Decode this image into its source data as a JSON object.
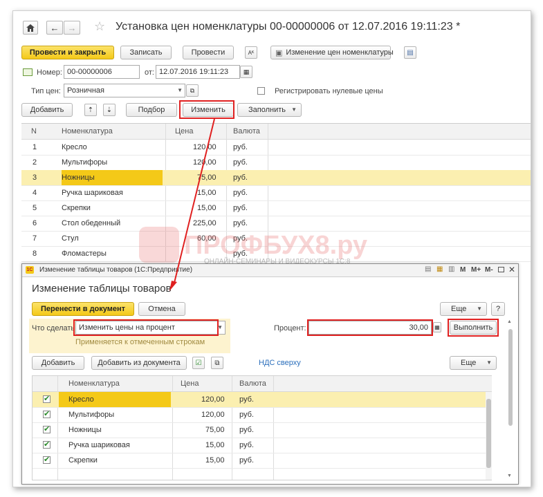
{
  "main_window": {
    "title": "Установка цен номенклатуры 00-00000006 от 12.07.2016 19:11:23 *",
    "toolbar": {
      "post_close": "Провести и закрыть",
      "save": "Записать",
      "post": "Провести",
      "change_prices": "Изменение цен номенклатуры"
    },
    "number_label": "Номер:",
    "number_value": "00-00000006",
    "from_label": "от:",
    "date_value": "12.07.2016 19:11:23",
    "price_type_label": "Тип цен:",
    "price_type_value": "Розничная",
    "register_zero_label": "Регистрировать нулевые цены",
    "table_toolbar": {
      "add": "Добавить",
      "select": "Подбор",
      "change": "Изменить",
      "fill": "Заполнить"
    },
    "table": {
      "headers": [
        "N",
        "Номенклатура",
        "Цена",
        "Валюта"
      ],
      "rows": [
        {
          "n": "1",
          "name": "Кресло",
          "price": "120,00",
          "currency": "руб."
        },
        {
          "n": "2",
          "name": "Мультифоры",
          "price": "120,00",
          "currency": "руб."
        },
        {
          "n": "3",
          "name": "Ножницы",
          "price": "75,00",
          "currency": "руб."
        },
        {
          "n": "4",
          "name": "Ручка шариковая",
          "price": "15,00",
          "currency": "руб."
        },
        {
          "n": "5",
          "name": "Скрепки",
          "price": "15,00",
          "currency": "руб."
        },
        {
          "n": "6",
          "name": "Стол обеденный",
          "price": "225,00",
          "currency": "руб."
        },
        {
          "n": "7",
          "name": "Стул",
          "price": "60,00",
          "currency": "руб."
        },
        {
          "n": "8",
          "name": "Фломастеры",
          "price": "",
          "currency": "руб."
        }
      ]
    }
  },
  "watermark": {
    "brand": "ПРОФБУХ8.ру",
    "tagline": "ОНЛАЙН-СЕМИНАРЫ И ВИДЕОКУРСЫ 1С:8"
  },
  "dialog": {
    "window_title": "Изменение таблицы товаров  (1С:Предприятие)",
    "title_controls": [
      "M",
      "M+",
      "M-"
    ],
    "heading": "Изменение таблицы товаров",
    "transfer": "Перенести в документ",
    "cancel": "Отмена",
    "more": "Еще",
    "help": "?",
    "action_label": "Что сделать:",
    "action_value": "Изменить цены на процент",
    "action_hint": "Применяется к отмеченным строкам",
    "percent_label": "Процент:",
    "percent_value": "30,00",
    "execute": "Выполнить",
    "add": "Добавить",
    "add_from_doc": "Добавить из документа",
    "vat_link": "НДС сверху",
    "more2": "Еще",
    "table": {
      "headers": [
        "",
        "Номенклатура",
        "Цена",
        "Валюта"
      ],
      "rows": [
        {
          "checked": true,
          "name": "Кресло",
          "price": "120,00",
          "currency": "руб."
        },
        {
          "checked": true,
          "name": "Мультифоры",
          "price": "120,00",
          "currency": "руб."
        },
        {
          "checked": true,
          "name": "Ножницы",
          "price": "75,00",
          "currency": "руб."
        },
        {
          "checked": true,
          "name": "Ручка шариковая",
          "price": "15,00",
          "currency": "руб."
        },
        {
          "checked": true,
          "name": "Скрепки",
          "price": "15,00",
          "currency": "руб."
        }
      ]
    }
  },
  "colors": {
    "accent_yellow": "#f4c918",
    "highlight_red": "#e02020",
    "selected_row": "#fbefb0"
  }
}
